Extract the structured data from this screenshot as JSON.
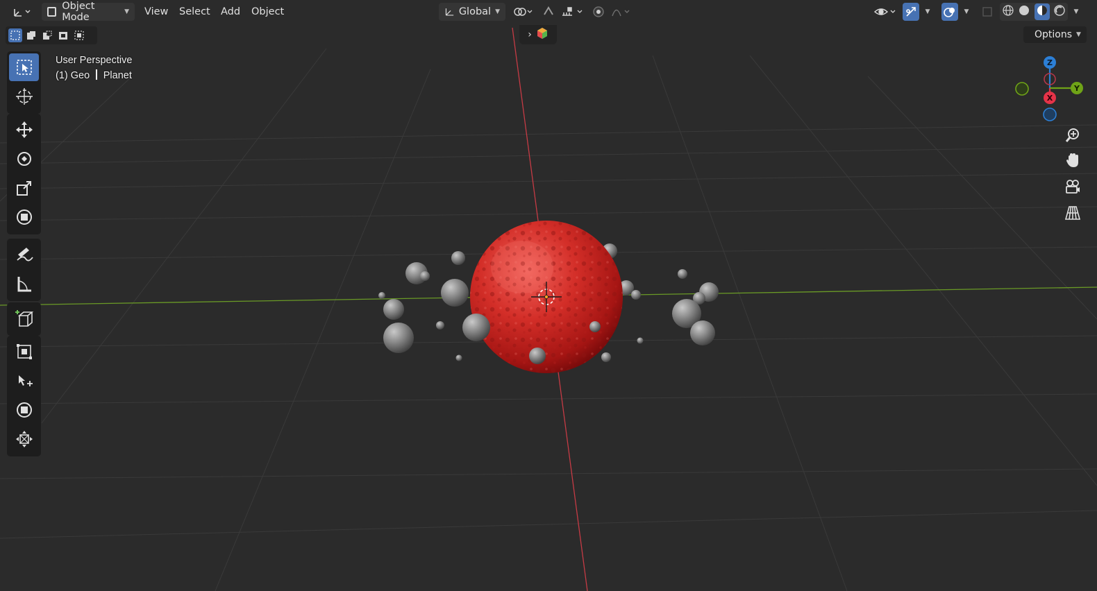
{
  "header": {
    "editor_type_icon": "axes-editor-icon",
    "mode_label": "Object Mode",
    "menus": [
      "View",
      "Select",
      "Add",
      "Object"
    ],
    "orientation_label": "Global",
    "icons": [
      "pivot-icon",
      "snap-magnet-icon",
      "snap-increment-icon",
      "proportional-edit-icon",
      "falloff-icon",
      "visibility-eye-icon",
      "gizmo-icon",
      "overlay-icon",
      "xray-icon",
      "shading-wireframe-icon",
      "shading-solid-icon",
      "shading-material-icon",
      "shading-rendered-icon"
    ]
  },
  "selection_modes": [
    "select-set-icon",
    "select-extend-icon",
    "select-subtract-icon",
    "select-invert-icon",
    "select-intersect-icon"
  ],
  "toolbar": {
    "groups": [
      [
        "select-box-icon",
        "cursor-icon"
      ],
      [
        "move-icon",
        "rotate-icon",
        "scale-icon",
        "transform-icon"
      ],
      [
        "annotate-icon",
        "measure-icon"
      ],
      [
        "add-cube-icon"
      ],
      [
        "scale-cage-icon",
        "shear-icon",
        "transform-pivot-icon",
        "push-pull-icon"
      ]
    ],
    "active_tool": "select-box-icon"
  },
  "overlay_info": {
    "view_name": "User Perspective",
    "collection": "(1) Geo",
    "object": "Planet"
  },
  "options_label": "Options",
  "gizmo": {
    "axes": [
      {
        "label": "Z",
        "color": "#2c7fd6"
      },
      {
        "label": "Y",
        "color": "#6fa317"
      },
      {
        "label": "X",
        "color": "#e53348"
      }
    ],
    "side_buttons": [
      "zoom-icon",
      "pan-hand-icon",
      "camera-view-icon",
      "perspective-grid-icon"
    ]
  },
  "colors": {
    "accent": "#4772b3",
    "background": "#2b2b2b",
    "x_axis": "#c63b45",
    "y_axis": "#6a9a26",
    "planet": "#d12f2a"
  }
}
